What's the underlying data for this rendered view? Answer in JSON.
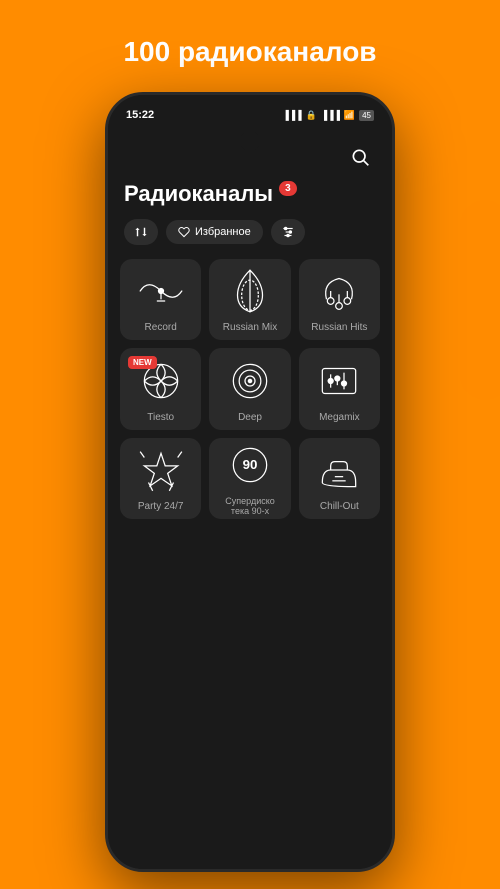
{
  "header": {
    "title": "100 радиоканалов"
  },
  "status_bar": {
    "time": "15:22",
    "battery": "45"
  },
  "app": {
    "page_title": "Радиоканалы",
    "badge_count": "3",
    "filter_bar": {
      "sort_label": "↑↓",
      "favorites_label": "Избранное",
      "eq_label": "⚙"
    },
    "channels": [
      {
        "name": "Record",
        "icon": "record",
        "new": false
      },
      {
        "name": "Russian Mix",
        "icon": "russian-mix",
        "new": false
      },
      {
        "name": "Russian Hits",
        "icon": "russian-hits",
        "new": false
      },
      {
        "name": "Tiesto",
        "icon": "tiesto",
        "new": true
      },
      {
        "name": "Deep",
        "icon": "deep",
        "new": false
      },
      {
        "name": "Megamix",
        "icon": "megamix",
        "new": false
      },
      {
        "name": "Party 24/7",
        "icon": "party",
        "new": false
      },
      {
        "name": "Супердиско\nтека 90-х",
        "icon": "disco90",
        "new": false
      },
      {
        "name": "Chill-Out",
        "icon": "chillout",
        "new": false
      }
    ]
  }
}
